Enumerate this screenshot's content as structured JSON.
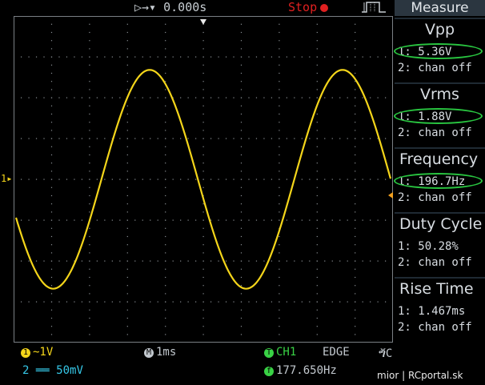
{
  "top": {
    "timebase_icon": "run-arrows-icon",
    "time_offset": "0.000s",
    "status": "Stop",
    "trigger_icon": "rising-edge-icon"
  },
  "panel": {
    "title": "Measure",
    "measurements": [
      {
        "name": "Vpp",
        "ch1": "1: 5.36V",
        "ch2": "2: chan off",
        "highlighted": true
      },
      {
        "name": "Vrms",
        "ch1": "1: 1.88V",
        "ch2": "2: chan off",
        "highlighted": true
      },
      {
        "name": "Frequency",
        "ch1": "1: 196.7Hz",
        "ch2": "2: chan off",
        "highlighted": true
      },
      {
        "name": "Duty Cycle",
        "ch1": "1: 50.28%",
        "ch2": "2: chan off",
        "highlighted": false
      },
      {
        "name": "Rise Time",
        "ch1": "1: 1.467ms",
        "ch2": "2: chan off",
        "highlighted": false
      }
    ]
  },
  "bottom": {
    "ch1_badge": "1",
    "ch1_setting": "~1V",
    "ch2_badge": "2",
    "ch2_setting": "══ 50mV",
    "horiz_badge": "M",
    "horiz_setting": "1ms",
    "trig_badge": "T",
    "trig_source": "CH1",
    "trig_type": "EDGE",
    "trig_coupling": "ⷝC",
    "freq_badge": "f",
    "trig_freq": "177.650Hz",
    "credit": "mior | RCportal.sk"
  },
  "ch1_marker": "1",
  "colors": {
    "trace": "#f4d51a",
    "highlight": "#29c540",
    "stop": "#e02020",
    "ch2": "#36c8e8",
    "panel_header": "#2b3640"
  },
  "waveform": {
    "channel": 1,
    "shape": "sine",
    "frequency_hz": 196.7,
    "vpp_v": 5.36,
    "volts_per_div": 1,
    "time_per_div_ms": 1
  }
}
